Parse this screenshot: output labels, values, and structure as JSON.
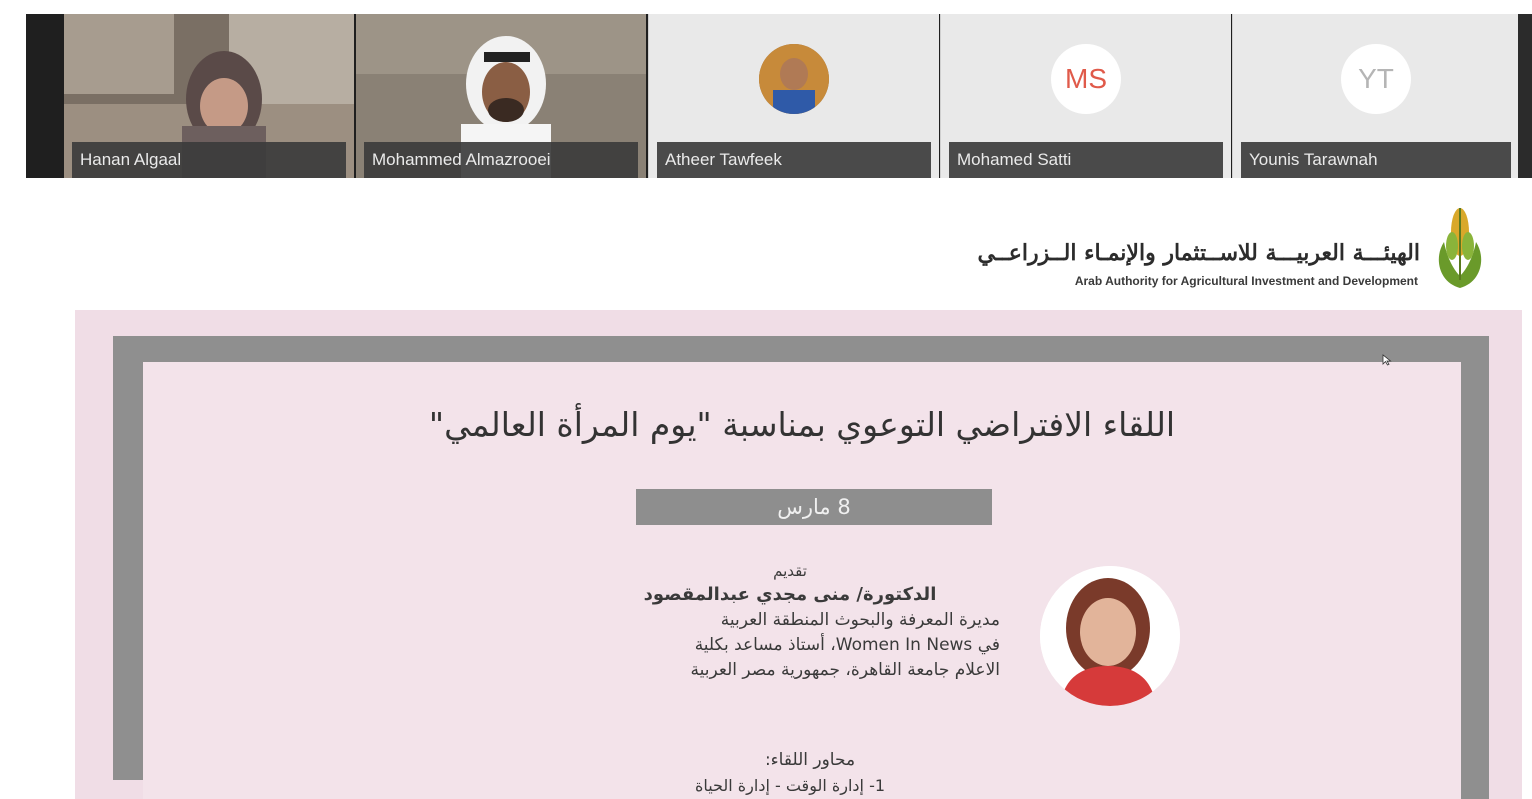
{
  "participants": [
    {
      "name": "Hanan Algaal",
      "type": "video"
    },
    {
      "name": "Mohammed Almazrooei",
      "type": "video"
    },
    {
      "name": "Atheer Tawfeek",
      "type": "photo"
    },
    {
      "name": "Mohamed Satti",
      "type": "initials",
      "initials": "MS",
      "initials_color": "#e05a4a"
    },
    {
      "name": "Younis Tarawnah",
      "type": "initials",
      "initials": "YT",
      "initials_color": "#b5b5b5"
    }
  ],
  "logo": {
    "arabic_name": "الهيئـــة العربيـــة للاســتثمار والإنمـاء الــزراعــي",
    "english_name": "Arab Authority for Agricultural Investment and Development"
  },
  "slide": {
    "title": "اللقاء الافتراضي التوعوي بمناسبة \"يوم المرأة العالمي\"",
    "date": "8 مارس",
    "presented_by_label": "تقديم",
    "presenter_name": "الدكتورة/ منى مجدي عبدالمقصود",
    "presenter_lines": [
      "مديرة المعرفة والبحوث المنطقة العربية",
      "في Women In News، أستاذ مساعد بكلية",
      "الاعلام جامعة القاهرة، جمهورية مصر العربية"
    ],
    "agenda_title": "محاور اللقاء:",
    "agenda_first_item": "1- إدارة الوقت - إدارة الحياة"
  },
  "colors": {
    "slide_background": "#f0dde6",
    "frame": "#8f8f8f",
    "logo_green": "#6a9a2a",
    "logo_gold": "#d9a82a"
  }
}
